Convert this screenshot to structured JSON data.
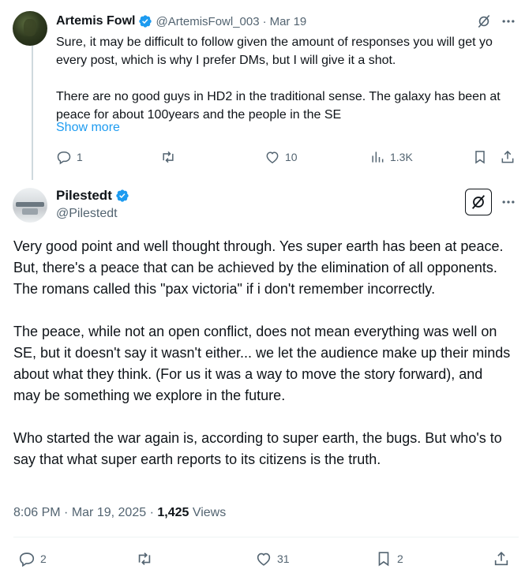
{
  "reply_tweet": {
    "author_name": "Artemis Fowl",
    "handle": "@ArtemisFowl_003",
    "separator": "·",
    "date": "Mar 19",
    "paragraphs": [
      "Sure, it may be difficult to follow given the amount of responses you will get yo every post, which is why I prefer DMs, but I will give it a shot.",
      "There are no good guys in HD2 in the traditional sense. The galaxy has been at peace for about 100years and the people in the SE"
    ],
    "show_more": "Show more",
    "stats": {
      "replies": "1",
      "reposts": "",
      "likes": "10",
      "views": "1.3K"
    }
  },
  "main_tweet": {
    "author_name": "Pilestedt",
    "handle": "@Pilestedt",
    "paragraphs": [
      "Very good point and well thought through. Yes super earth has been at peace. But, there's a peace that can be achieved by the elimination of all opponents. The romans called this \"pax victoria\" if i don't remember incorrectly.",
      "The peace, while not an open conflict, does not mean everything was well on SE, but it doesn't say it wasn't either... we let the audience make up their minds about what they think. (For us it was a way to move the story forward), and may be something we explore in the future.",
      "Who started the war again is, according to super earth, the bugs. But who's to say that what super earth reports to its citizens is the truth."
    ],
    "time": "8:06 PM",
    "separator": "·",
    "date": "Mar 19, 2025",
    "view_count": "1,425",
    "views_label": "Views",
    "stats": {
      "replies": "2",
      "reposts": "",
      "likes": "31",
      "bookmarks": "2"
    }
  },
  "colors": {
    "accent": "#1d9bf0",
    "text": "#0f1419",
    "secondary": "#536471",
    "thread_line": "#cfd9de"
  },
  "icons": [
    "verified-badge-icon",
    "grok-icon",
    "more-icon",
    "reply-icon",
    "repost-icon",
    "like-icon",
    "views-icon",
    "bookmark-icon",
    "share-icon"
  ]
}
